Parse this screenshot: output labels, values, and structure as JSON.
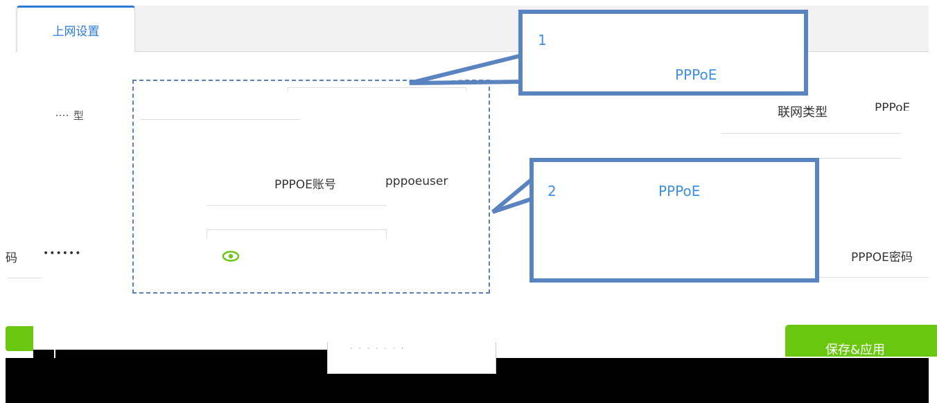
{
  "tabs": [
    {
      "label": "上网设置",
      "active": true
    }
  ],
  "form": {
    "connection_type": {
      "label": "联网类型",
      "value": "PPPoE"
    },
    "pppoe_account": {
      "label": "PPPOE账号",
      "value": "pppoeuser"
    },
    "pppoe_password": {
      "label": "PPPOE密码",
      "value": "••••••"
    },
    "partial_password_label": "码"
  },
  "callouts": [
    {
      "number": "1",
      "text": "PPPoE"
    },
    {
      "number": "2",
      "text": "PPPoE"
    }
  ],
  "buttons": {
    "save_label": "保存&应用"
  },
  "icons": {
    "eye": "eye-icon"
  },
  "colors": {
    "accent_blue": "#2b7bd6",
    "callout_border": "#5a84c0",
    "green_button": "#6ac70f",
    "eye_green": "#6ac70f"
  }
}
